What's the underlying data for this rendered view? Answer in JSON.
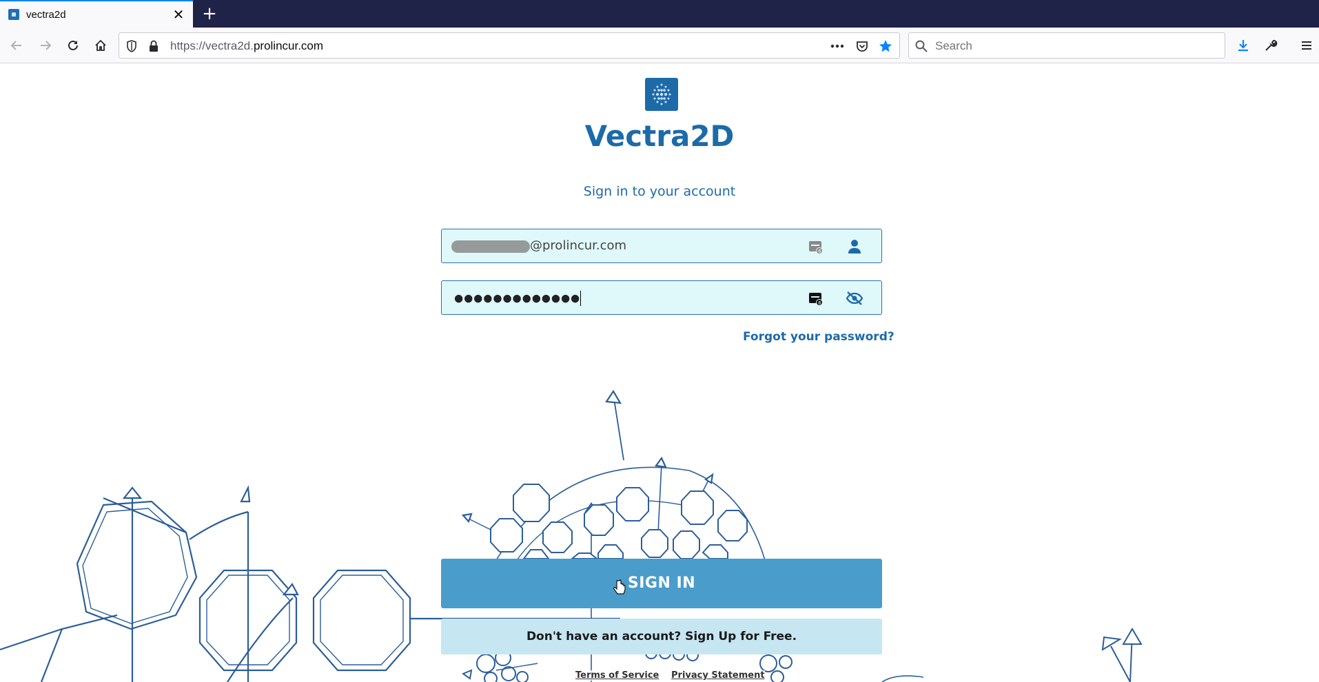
{
  "browser": {
    "tab": {
      "title": "vectra2d",
      "close_glyph": "✕",
      "favicon": "vectra2d-favicon"
    },
    "new_tab_glyph": "+",
    "url": {
      "prefix": "https://vectra2d.",
      "domain": "prolincur.com"
    },
    "search_placeholder": "Search",
    "icons": {
      "back": "arrow-left-icon",
      "forward": "arrow-right-icon",
      "reload": "reload-icon",
      "home": "home-icon",
      "tracking": "shield-icon",
      "lock": "lock-icon",
      "more": "ellipsis-icon",
      "pocket": "pocket-icon",
      "bookmark": "star-icon",
      "download": "download-icon",
      "tools": "wrench-icon",
      "menu": "hamburger-icon"
    },
    "colors": {
      "tabbar": "#1f2347",
      "accent": "#0a84ff"
    }
  },
  "page": {
    "brand": "Vectra2D",
    "subtitle": "Sign in to your account",
    "email": {
      "value_visible": "@prolincur.com"
    },
    "password": {
      "value": "●●●●●●●●●●●●●"
    },
    "forgot_password": "Forgot your password?",
    "sign_in": "SIGN IN",
    "sign_up": "Don't have an account? Sign Up for Free.",
    "footer": {
      "terms": "Terms of Service",
      "privacy": "Privacy Statement"
    },
    "colors": {
      "brand": "#1d6aa8",
      "button": "#4a9ccb",
      "field_bg": "#dff8fa",
      "signup_bg": "#c6e6f2"
    }
  }
}
